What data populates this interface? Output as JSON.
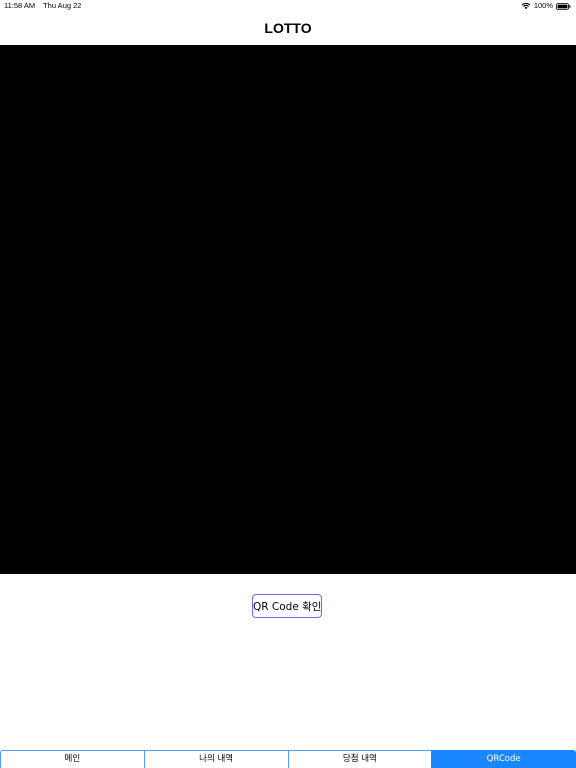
{
  "status_bar": {
    "time": "11:58 AM",
    "date": "Thu Aug 22",
    "battery": "100%",
    "wifi_icon": "wifi-icon",
    "battery_icon": "battery-icon"
  },
  "nav": {
    "title": "LOTTO"
  },
  "main": {
    "qr_button_label": "QR Code 확인"
  },
  "tab_bar": {
    "tabs": [
      {
        "label": "메인",
        "active": false
      },
      {
        "label": "나의 내역",
        "active": false
      },
      {
        "label": "당첨 내역",
        "active": false
      },
      {
        "label": "QRCode",
        "active": true
      }
    ]
  },
  "colors": {
    "accent": "#1a87ff",
    "tab_border": "#4a9df5",
    "button_border": "#6b6ef5",
    "camera_background": "#000000"
  }
}
